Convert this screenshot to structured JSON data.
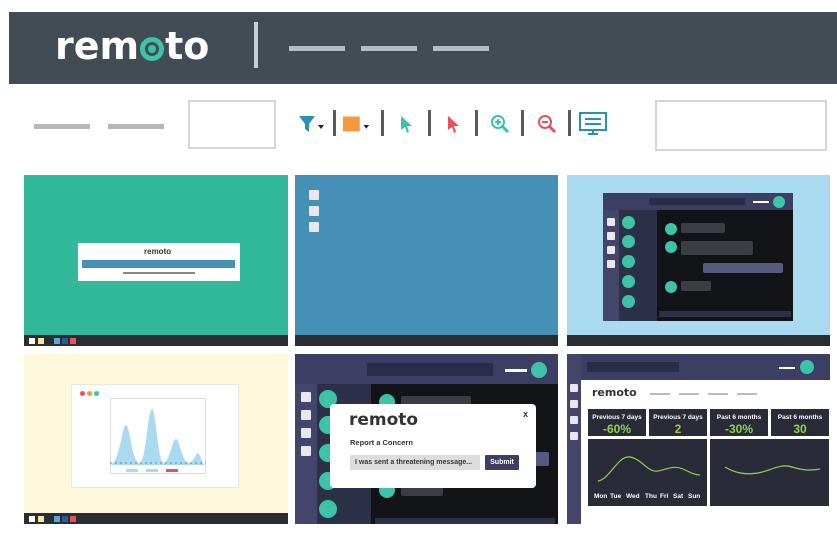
{
  "header": {
    "brand": "remoto",
    "nav_items": [
      "",
      "",
      ""
    ]
  },
  "toolbar": {
    "left_items": [
      "",
      ""
    ],
    "tools": [
      "filter-icon",
      "color-swatch-icon",
      "pointer-icon",
      "pointer-red-icon",
      "zoom-in-icon",
      "zoom-out-icon",
      "monitor-settings-icon"
    ],
    "colors": {
      "filter": "#2a8fb8",
      "swatch": "#f49a3c",
      "pointer_teal": "#3cc3a8",
      "pointer_red": "#e8505b",
      "zoom": "#3cc3a8",
      "zoom_out": "#e8505b",
      "monitor": "#2a8fb8"
    }
  },
  "tiles": {
    "login": {
      "brand": "remoto",
      "bg": "#32b99a"
    },
    "desktop": {
      "bg": "#4491b5"
    },
    "chat": {
      "bg": "#a9daf0"
    },
    "chart": {
      "bg": "#fdf7dc"
    },
    "dialog": {
      "brand": "remoto",
      "close": "x",
      "title": "Report a Concern",
      "input_value": "I was sent a threatening message...",
      "submit": "Submit"
    },
    "dashboard": {
      "brand": "remoto",
      "stats": [
        {
          "label": "Previous 7 days",
          "value": "-60%"
        },
        {
          "label": "Previous 7 days",
          "value": "2"
        },
        {
          "label": "Past 6 months",
          "value": "-30%"
        },
        {
          "label": "Past 6 months",
          "value": "30"
        }
      ],
      "days": [
        "Mon",
        "Tue",
        "Wed",
        "Thu",
        "Fri",
        "Sat",
        "Sun"
      ]
    }
  }
}
